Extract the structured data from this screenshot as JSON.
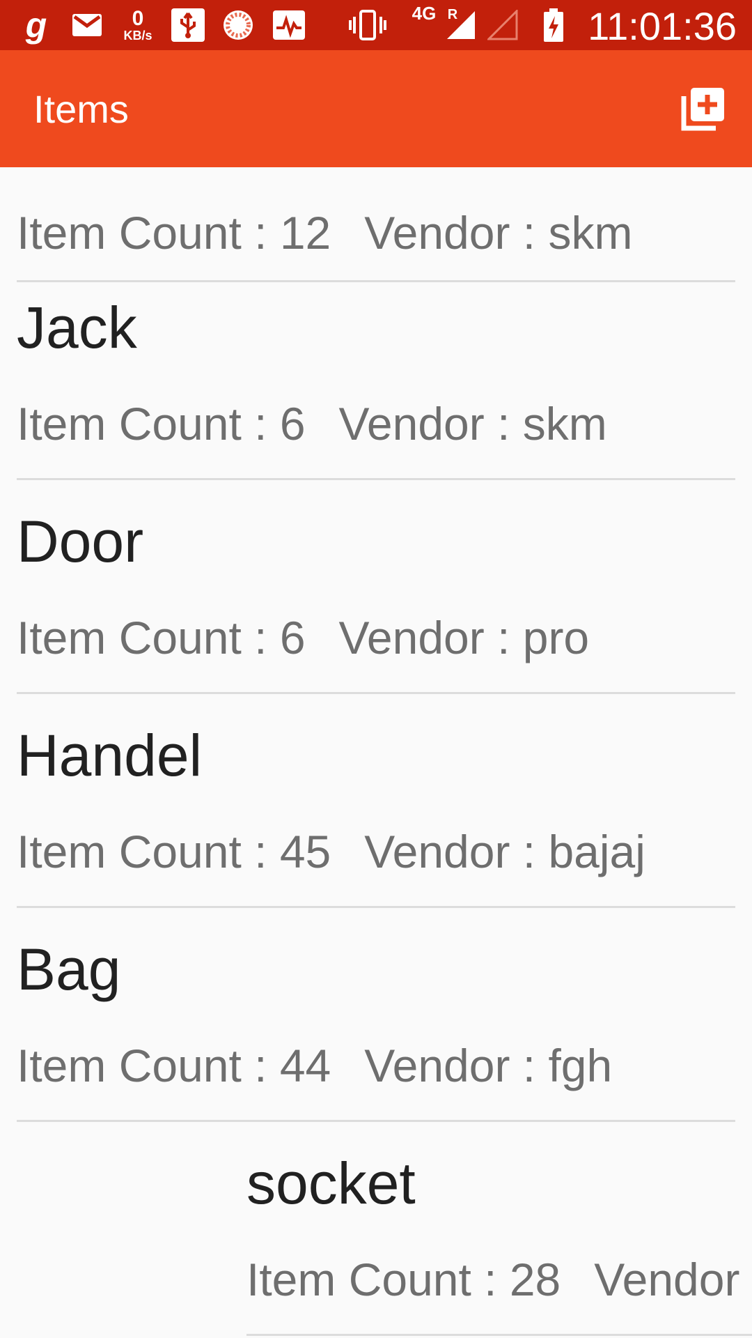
{
  "status_bar": {
    "time": "11:01:36",
    "net_speed_value": "0",
    "net_speed_unit": "KB/s",
    "network_type": "4G",
    "roaming": "R",
    "icons": [
      "g-app-icon",
      "gmail-icon",
      "net-speed-icon",
      "usb-icon",
      "sync-circle-icon",
      "activity-icon",
      "vibrate-icon",
      "signal-4g-icon",
      "signal-empty-icon",
      "battery-charging-icon"
    ]
  },
  "app_bar": {
    "title": "Items",
    "add_icon": "library-add-icon",
    "colors": {
      "status": "#c2200b",
      "toolbar": "#ef4a1e"
    }
  },
  "list": {
    "count_label": "Item Count : ",
    "vendor_label": "Vendor : ",
    "items": [
      {
        "name": "",
        "count": "12",
        "vendor": "skm"
      },
      {
        "name": "Jack",
        "count": "6",
        "vendor": "skm"
      },
      {
        "name": "Door",
        "count": "6",
        "vendor": "pro"
      },
      {
        "name": "Handel",
        "count": "45",
        "vendor": "bajaj"
      },
      {
        "name": "Bag",
        "count": "44",
        "vendor": "fgh"
      },
      {
        "name": "socket",
        "count": "28",
        "vendor": ""
      }
    ]
  }
}
